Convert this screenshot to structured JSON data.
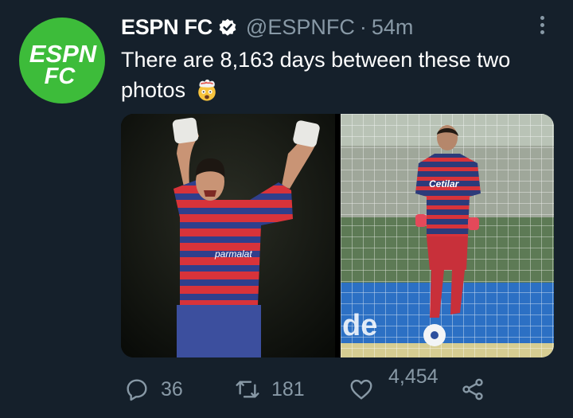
{
  "account": {
    "display_name": "ESPN FC",
    "handle": "@ESPNFC",
    "separator": "·",
    "time": "54m",
    "avatar_text_line1": "ESPN",
    "avatar_text_line2": "FC",
    "avatar_color": "#3dbc3a",
    "verified_icon": "verified-badge-icon"
  },
  "tweet": {
    "text": "There are 8,163 days between these two photos",
    "emoji": "exploding-head-emoji"
  },
  "media": {
    "left_photo": {
      "jersey_text": "parmalat"
    },
    "right_photo": {
      "jersey_text": "Cetilar",
      "board_text": "de"
    }
  },
  "actions": {
    "reply_count": "36",
    "retweet_count": "181",
    "like_count": "4,454",
    "reply_icon": "reply-icon",
    "retweet_icon": "retweet-icon",
    "like_icon": "heart-icon",
    "share_icon": "share-icon"
  },
  "colors": {
    "background": "#15202b",
    "muted_text": "#8899a6",
    "text": "#ffffff"
  }
}
